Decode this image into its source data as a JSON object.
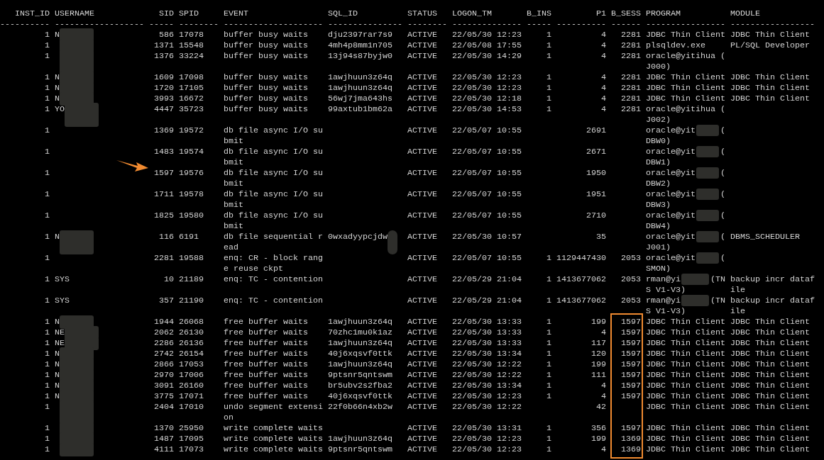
{
  "columns": [
    {
      "header": "INST_ID",
      "rule": "----------"
    },
    {
      "header": "USERNAME",
      "rule": "------------------"
    },
    {
      "header": "SID",
      "rule": "-----"
    },
    {
      "header": "SPID",
      "rule": "--------"
    },
    {
      "header": "EVENT",
      "rule": "--------------------"
    },
    {
      "header": "SQL_ID",
      "rule": "---------------"
    },
    {
      "header": "STATUS",
      "rule": "--------"
    },
    {
      "header": "LOGON_TM",
      "rule": "--------------"
    },
    {
      "header": "B_INS",
      "rule": "-----"
    },
    {
      "header": "P1",
      "rule": "----------"
    },
    {
      "header": "B_SESS",
      "rule": "------"
    },
    {
      "header": "PROGRAM",
      "rule": "----------------"
    },
    {
      "header": "MODULE",
      "rule": "-----------------"
    }
  ],
  "rows": [
    {
      "inst_id": "1",
      "username": "N",
      "username_redacted": true,
      "sid": "586",
      "spid": "17078",
      "event": [
        "buffer busy waits"
      ],
      "sql_id": "dju2397rar7s9",
      "status": "ACTIVE",
      "logon_tm": "22/05/30 12:23",
      "b_ins": "1",
      "p1": "4",
      "b_sess": "2281",
      "program": [
        "JDBC Thin Client"
      ],
      "module": [
        "JDBC Thin Client"
      ]
    },
    {
      "inst_id": "1",
      "username_redacted": true,
      "sid": "1371",
      "spid": "15548",
      "event": [
        "buffer busy waits"
      ],
      "sql_id": "4mh4p8mm1n705",
      "status": "ACTIVE",
      "logon_tm": "22/05/08 17:55",
      "b_ins": "1",
      "p1": "4",
      "b_sess": "2281",
      "program": [
        "plsqldev.exe"
      ],
      "module": [
        "PL/SQL Developer"
      ]
    },
    {
      "inst_id": "1",
      "username_redacted": true,
      "sid": "1376",
      "spid": "33224",
      "event": [
        "buffer busy waits"
      ],
      "sql_id": "13j94s87byjw0",
      "status": "ACTIVE",
      "logon_tm": "22/05/30 14:29",
      "b_ins": "1",
      "p1": "4",
      "b_sess": "2281",
      "program": [
        "oracle@yitihua (",
        "J000)"
      ]
    },
    {
      "inst_id": "1",
      "username": "N",
      "username_redacted": true,
      "sid": "1609",
      "spid": "17098",
      "event": [
        "buffer busy waits"
      ],
      "sql_id": "1awjhuun3z64q",
      "status": "ACTIVE",
      "logon_tm": "22/05/30 12:23",
      "b_ins": "1",
      "p1": "4",
      "b_sess": "2281",
      "program": [
        "JDBC Thin Client"
      ],
      "module": [
        "JDBC Thin Client"
      ]
    },
    {
      "inst_id": "1",
      "username": "N",
      "username_redacted": true,
      "sid": "1720",
      "spid": "17105",
      "event": [
        "buffer busy waits"
      ],
      "sql_id": "1awjhuun3z64q",
      "status": "ACTIVE",
      "logon_tm": "22/05/30 12:23",
      "b_ins": "1",
      "p1": "4",
      "b_sess": "2281",
      "program": [
        "JDBC Thin Client"
      ],
      "module": [
        "JDBC Thin Client"
      ]
    },
    {
      "inst_id": "1",
      "username": "N",
      "username_redacted": true,
      "sid": "3993",
      "spid": "16672",
      "event": [
        "buffer busy waits"
      ],
      "sql_id": "56wj7jma643hs",
      "status": "ACTIVE",
      "logon_tm": "22/05/30 12:18",
      "b_ins": "1",
      "p1": "4",
      "b_sess": "2281",
      "program": [
        "JDBC Thin Client"
      ],
      "module": [
        "JDBC Thin Client"
      ]
    },
    {
      "inst_id": "1",
      "username": "YO",
      "username_redacted": true,
      "sid": "4447",
      "spid": "35723",
      "event": [
        "buffer busy waits"
      ],
      "sql_id": "99axtub1bm62a",
      "status": "ACTIVE",
      "logon_tm": "22/05/30 14:53",
      "b_ins": "1",
      "p1": "4",
      "b_sess": "2281",
      "program": [
        "oracle@yitihua (",
        "J002)"
      ]
    },
    {
      "inst_id": "1",
      "sid": "1369",
      "spid": "19572",
      "event": [
        "db file async I/O su",
        "bmit"
      ],
      "status": "ACTIVE",
      "logon_tm": "22/05/07 10:55",
      "p1": "2691",
      "program": [
        "oracle@yit",
        "DBW0)"
      ],
      "program_redacted": true,
      "program_tail": "("
    },
    {
      "inst_id": "1",
      "sid": "1483",
      "spid": "19574",
      "event": [
        "db file async I/O su",
        "bmit"
      ],
      "status": "ACTIVE",
      "logon_tm": "22/05/07 10:55",
      "p1": "2671",
      "program": [
        "oracle@yit",
        "DBW1)"
      ],
      "program_redacted": true,
      "program_tail": "("
    },
    {
      "inst_id": "1",
      "sid": "1597",
      "sid_arrow": true,
      "spid": "19576",
      "event": [
        "db file async I/O su",
        "bmit"
      ],
      "status": "ACTIVE",
      "logon_tm": "22/05/07 10:55",
      "p1": "1950",
      "program": [
        "oracle@yit",
        "DBW2)"
      ],
      "program_redacted": true,
      "program_tail": "("
    },
    {
      "inst_id": "1",
      "sid": "1711",
      "spid": "19578",
      "event": [
        "db file async I/O su",
        "bmit"
      ],
      "status": "ACTIVE",
      "logon_tm": "22/05/07 10:55",
      "p1": "1951",
      "program": [
        "oracle@yit",
        "DBW3)"
      ],
      "program_redacted": true,
      "program_tail": "("
    },
    {
      "inst_id": "1",
      "sid": "1825",
      "spid": "19580",
      "event": [
        "db file async I/O su",
        "bmit"
      ],
      "status": "ACTIVE",
      "logon_tm": "22/05/07 10:55",
      "p1": "2710",
      "program": [
        "oracle@yit",
        "DBW4)"
      ],
      "program_redacted": true,
      "program_tail": "("
    },
    {
      "inst_id": "1",
      "username": "N",
      "username_redacted": true,
      "sid": "116",
      "spid": "6191",
      "event": [
        "db file sequential r",
        "ead"
      ],
      "sql_id": "0wxadyypcjdw",
      "sql_id_redacted": true,
      "status": "ACTIVE",
      "logon_tm": "22/05/30 10:57",
      "p1": "35",
      "program": [
        "oracle@yit",
        "J001)"
      ],
      "program_redacted": true,
      "program_tail": "(",
      "module": [
        "DBMS_SCHEDULER"
      ]
    },
    {
      "inst_id": "1",
      "sid": "2281",
      "spid": "19588",
      "event": [
        "enq: CR - block rang",
        "e reuse ckpt"
      ],
      "status": "ACTIVE",
      "logon_tm": "22/05/07 10:55",
      "b_ins": "1",
      "p1": "1129447430",
      "b_sess": "2053",
      "program": [
        "oracle@yit",
        "SMON)"
      ],
      "program_redacted": true,
      "program_tail": "("
    },
    {
      "inst_id": "1",
      "username": "SYS",
      "sid": "10",
      "spid": "21189",
      "event": [
        "enq: TC - contention"
      ],
      "status": "ACTIVE",
      "logon_tm": "22/05/29 21:04",
      "b_ins": "1",
      "p1": "1413677062",
      "b_sess": "2053",
      "program": [
        "rman@yi",
        "S V1-V3)"
      ],
      "program_redacted": true,
      "program_tail": "(TN",
      "module": [
        "backup incr dataf",
        "ile"
      ]
    },
    {
      "inst_id": "1",
      "username": "SYS",
      "sid": "357",
      "spid": "21190",
      "event": [
        "enq: TC - contention"
      ],
      "status": "ACTIVE",
      "logon_tm": "22/05/29 21:04",
      "b_ins": "1",
      "p1": "1413677062",
      "b_sess": "2053",
      "program": [
        "rman@yi",
        "S V1-V3)"
      ],
      "program_redacted": true,
      "program_tail": "(TN",
      "module": [
        "backup incr dataf",
        "ile"
      ]
    },
    {
      "inst_id": "1",
      "username": "N",
      "username_redacted": true,
      "sid": "1944",
      "spid": "26068",
      "event": [
        "free buffer waits"
      ],
      "sql_id": "1awjhuun3z64q",
      "status": "ACTIVE",
      "logon_tm": "22/05/30 13:33",
      "b_ins": "1",
      "p1": "199",
      "b_sess": "1597",
      "b_sess_boxed": true,
      "program": [
        "JDBC Thin Client"
      ],
      "module": [
        "JDBC Thin Client"
      ]
    },
    {
      "inst_id": "1",
      "username": "NE",
      "username_redacted": true,
      "sid": "2062",
      "spid": "26130",
      "event": [
        "free buffer waits"
      ],
      "sql_id": "70zhc1mu0k1az",
      "status": "ACTIVE",
      "logon_tm": "22/05/30 13:33",
      "b_ins": "1",
      "p1": "4",
      "b_sess": "1597",
      "b_sess_boxed": true,
      "program": [
        "JDBC Thin Client"
      ],
      "module": [
        "JDBC Thin Client"
      ]
    },
    {
      "inst_id": "1",
      "username": "NE",
      "username_redacted": true,
      "sid": "2286",
      "spid": "26136",
      "event": [
        "free buffer waits"
      ],
      "sql_id": "1awjhuun3z64q",
      "status": "ACTIVE",
      "logon_tm": "22/05/30 13:33",
      "b_ins": "1",
      "p1": "117",
      "b_sess": "1597",
      "b_sess_boxed": true,
      "program": [
        "JDBC Thin Client"
      ],
      "module": [
        "JDBC Thin Client"
      ]
    },
    {
      "inst_id": "1",
      "username": "N",
      "username_redacted": true,
      "sid": "2742",
      "spid": "26154",
      "event": [
        "free buffer waits"
      ],
      "sql_id": "40j6xqsvf0ttk",
      "status": "ACTIVE",
      "logon_tm": "22/05/30 13:34",
      "b_ins": "1",
      "p1": "120",
      "b_sess": "1597",
      "b_sess_boxed": true,
      "program": [
        "JDBC Thin Client"
      ],
      "module": [
        "JDBC Thin Client"
      ]
    },
    {
      "inst_id": "1",
      "username": "N",
      "username_redacted": true,
      "sid": "2866",
      "spid": "17053",
      "event": [
        "free buffer waits"
      ],
      "sql_id": "1awjhuun3z64q",
      "status": "ACTIVE",
      "logon_tm": "22/05/30 12:22",
      "b_ins": "1",
      "p1": "199",
      "b_sess": "1597",
      "b_sess_boxed": true,
      "program": [
        "JDBC Thin Client"
      ],
      "module": [
        "JDBC Thin Client"
      ]
    },
    {
      "inst_id": "1",
      "username": "N",
      "username_redacted": true,
      "sid": "2970",
      "spid": "17006",
      "event": [
        "free buffer waits"
      ],
      "sql_id": "9ptsnr5qntswm",
      "status": "ACTIVE",
      "logon_tm": "22/05/30 12:22",
      "b_ins": "1",
      "p1": "111",
      "b_sess": "1597",
      "b_sess_boxed": true,
      "program": [
        "JDBC Thin Client"
      ],
      "module": [
        "JDBC Thin Client"
      ]
    },
    {
      "inst_id": "1",
      "username": "N",
      "username_redacted": true,
      "sid": "3091",
      "spid": "26160",
      "event": [
        "free buffer waits"
      ],
      "sql_id": "br5ubv2s2fba2",
      "status": "ACTIVE",
      "logon_tm": "22/05/30 13:34",
      "b_ins": "1",
      "p1": "4",
      "b_sess": "1597",
      "b_sess_boxed": true,
      "program": [
        "JDBC Thin Client"
      ],
      "module": [
        "JDBC Thin Client"
      ]
    },
    {
      "inst_id": "1",
      "username": "N",
      "username_redacted": true,
      "sid": "3775",
      "spid": "17071",
      "event": [
        "free buffer waits"
      ],
      "sql_id": "40j6xqsvf0ttk",
      "status": "ACTIVE",
      "logon_tm": "22/05/30 12:23",
      "b_ins": "1",
      "p1": "4",
      "b_sess": "1597",
      "b_sess_boxed": true,
      "program": [
        "JDBC Thin Client"
      ],
      "module": [
        "JDBC Thin Client"
      ]
    },
    {
      "inst_id": "1",
      "username_redacted": true,
      "sid": "2404",
      "spid": "17010",
      "event": [
        "undo segment extensi",
        "on"
      ],
      "sql_id": "22f0b66n4xb2w",
      "status": "ACTIVE",
      "logon_tm": "22/05/30 12:22",
      "p1": "42",
      "b_sess_boxed": true,
      "program": [
        "JDBC Thin Client"
      ],
      "module": [
        "JDBC Thin Client"
      ]
    },
    {
      "inst_id": "1",
      "username_redacted": true,
      "sid": "1370",
      "spid": "25950",
      "event": [
        "write complete waits"
      ],
      "status": "ACTIVE",
      "logon_tm": "22/05/30 13:31",
      "b_ins": "1",
      "p1": "356",
      "b_sess": "1597",
      "b_sess_boxed": true,
      "program": [
        "JDBC Thin Client"
      ],
      "module": [
        "JDBC Thin Client"
      ]
    },
    {
      "inst_id": "1",
      "username_redacted": true,
      "sid": "1487",
      "spid": "17095",
      "event": [
        "write complete waits"
      ],
      "sql_id": "1awjhuun3z64q",
      "status": "ACTIVE",
      "logon_tm": "22/05/30 12:23",
      "b_ins": "1",
      "p1": "199",
      "b_sess": "1369",
      "b_sess_boxed": true,
      "program": [
        "JDBC Thin Client"
      ],
      "module": [
        "JDBC Thin Client"
      ]
    },
    {
      "inst_id": "1",
      "username_redacted": true,
      "sid": "4111",
      "spid": "17073",
      "event": [
        "write complete waits"
      ],
      "sql_id": "9ptsnr5qntswm",
      "status": "ACTIVE",
      "logon_tm": "22/05/30 12:23",
      "b_ins": "1",
      "p1": "4",
      "b_sess": "1369",
      "b_sess_boxed": true,
      "program": [
        "JDBC Thin Client"
      ],
      "module": [
        "JDBC Thin Client"
      ]
    }
  ]
}
